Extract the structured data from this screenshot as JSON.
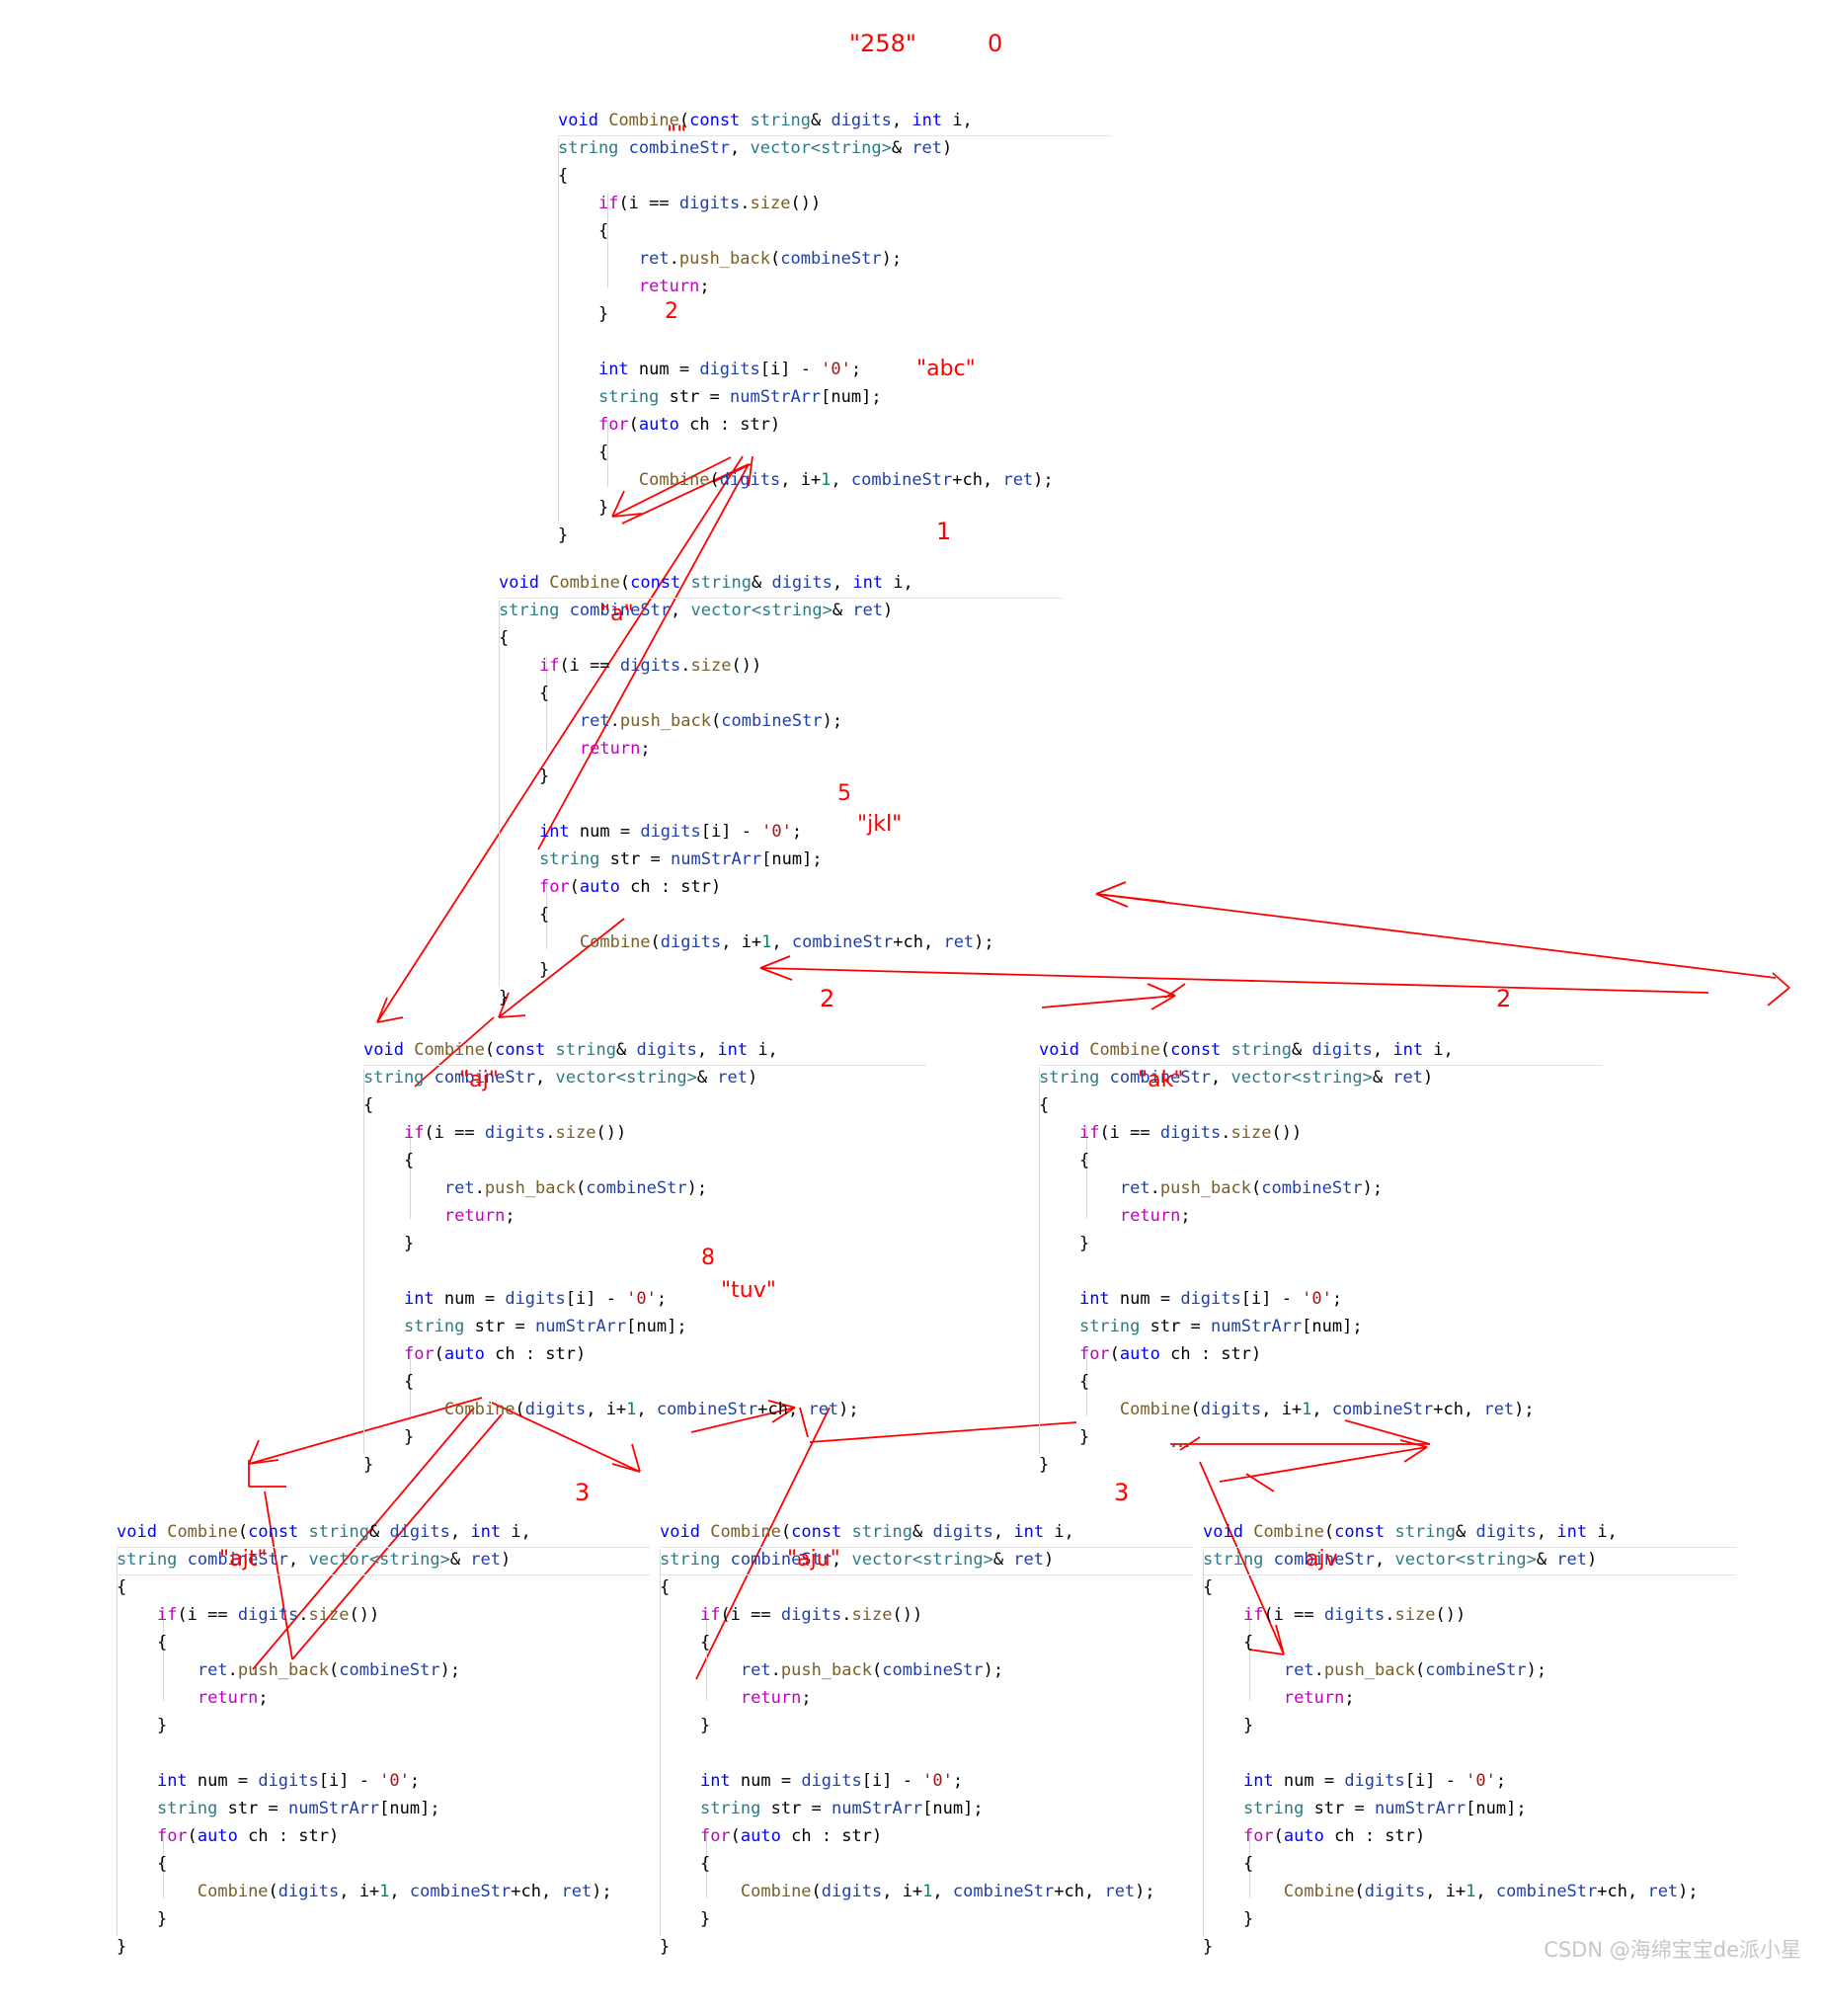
{
  "meta": {
    "watermark": "CSDN @海绵宝宝de派小星",
    "accent_red": "#fe0000",
    "keyword_blue": "#0000ff",
    "keyword_magenta": "#bf00bf",
    "type_teal": "#2b7b85",
    "function_brown": "#795e26",
    "variable_navy": "#1f3faa",
    "string_dark_red": "#a31515",
    "number_green": "#098658"
  },
  "code": {
    "signature_line1_parts": [
      "void",
      " ",
      "Combine",
      "(",
      "const",
      " ",
      "string",
      "& ",
      "digits",
      ", ",
      "int",
      " i,"
    ],
    "signature_line2_parts": [
      "string",
      " ",
      "combineStr",
      ", ",
      "vector<string>",
      "& ",
      "ret",
      ")"
    ],
    "lines": {
      "open_brace": "{",
      "if_check": "if(i == digits.size())",
      "inner_open": "{",
      "push_back": "ret.push_back(combineStr);",
      "return": "return;",
      "inner_close": "}",
      "int_num": "int num = digits[i] - '0';",
      "string_str": "string str = numStrArr[num];",
      "for_loop": "for(auto ch : str)",
      "recurse": "Combine(digits, i+1, combineStr+ch, ret);",
      "close_brace": "}"
    }
  },
  "blocks": [
    {
      "id": "root",
      "name": "combine-frame-root",
      "depth_label": "0",
      "digits_label": "\"258\"",
      "combine_str": "\"\"",
      "num_label": "2",
      "str_label": "\"abc\"",
      "has_str_value": true
    },
    {
      "id": "level1",
      "name": "combine-frame-level1",
      "depth_label": "1",
      "combine_str": "\"a\"",
      "num_label": "5",
      "str_label": "\"jkl\"",
      "has_str_value": true
    },
    {
      "id": "level2-left",
      "name": "combine-frame-level2-left",
      "depth_label": "2",
      "combine_str": "\"aj\"",
      "num_label": "8",
      "str_label": "\"tuv\"",
      "has_str_value": true
    },
    {
      "id": "level2-right",
      "name": "combine-frame-level2-right",
      "depth_label": "2",
      "combine_str": "\"ak\"",
      "num_label": "",
      "str_label": "",
      "has_str_value": false
    },
    {
      "id": "level3-left",
      "name": "combine-frame-level3-left",
      "depth_label": "3",
      "combine_str": "\"ajt\"",
      "num_label": "",
      "str_label": "",
      "has_str_value": false
    },
    {
      "id": "level3-mid",
      "name": "combine-frame-level3-mid",
      "depth_label": "3",
      "combine_str": "\"aju\"",
      "num_label": "",
      "str_label": "",
      "has_str_value": false
    },
    {
      "id": "level3-right",
      "name": "combine-frame-level3-right",
      "depth_label": "",
      "combine_str": "ajv",
      "num_label": "",
      "str_label": "",
      "has_str_value": false
    }
  ],
  "annotations": {
    "root_digits": "\"258\"",
    "root_index": "0",
    "root_combine": "\"\"",
    "root_num": "2",
    "root_str": "\"abc\"",
    "l1_index": "1",
    "l1_combine": "\"a\"",
    "l1_num": "5",
    "l1_str": "\"jkl\"",
    "l2left_index": "2",
    "l2left_combine": "\"aj\"",
    "l2left_num": "8",
    "l2left_str": "\"tuv\"",
    "l2right_index": "2",
    "l2right_index_b": "2",
    "l2right_combine": "\"ak\"",
    "l3left_index": "3",
    "l3left_combine": "\"ajt\"",
    "l3mid_index": "3",
    "l3mid_combine": "\"aju\"",
    "l3right_combine": "ajv",
    "ellipsis": "..."
  }
}
